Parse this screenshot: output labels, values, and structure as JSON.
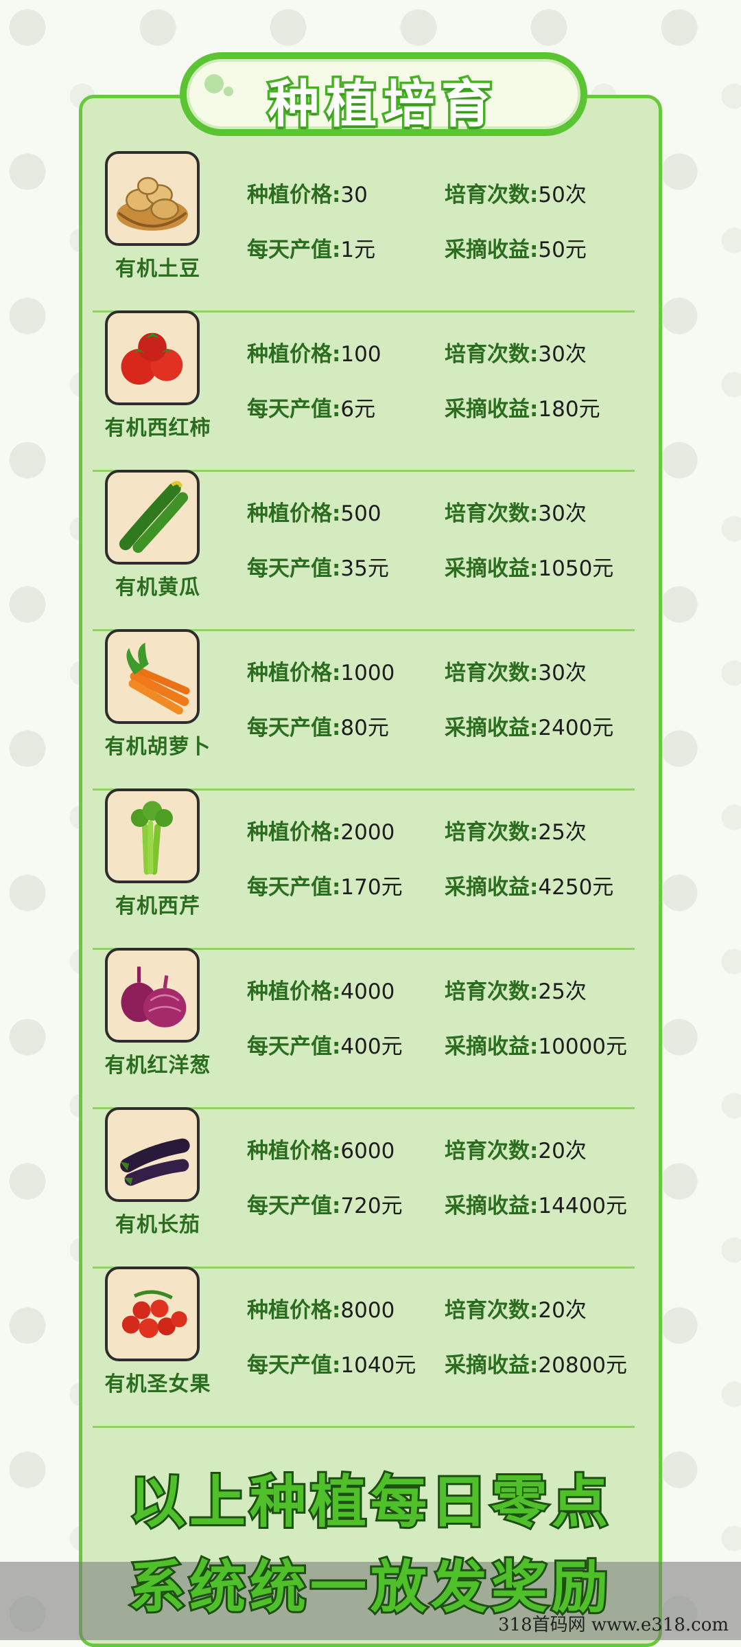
{
  "title": "种植培育",
  "labels": {
    "price": "种植价格:",
    "times": "培育次数:",
    "daily": "每天产值:",
    "harvest": "采摘收益:"
  },
  "items": [
    {
      "name": "有机土豆",
      "icon": "potato-icon",
      "price": "30",
      "times": "50次",
      "daily": "1元",
      "harvest": "50元"
    },
    {
      "name": "有机西红柿",
      "icon": "tomato-icon",
      "price": "100",
      "times": "30次",
      "daily": "6元",
      "harvest": "180元"
    },
    {
      "name": "有机黄瓜",
      "icon": "cucumber-icon",
      "price": "500",
      "times": "30次",
      "daily": "35元",
      "harvest": "1050元"
    },
    {
      "name": "有机胡萝卜",
      "icon": "carrot-icon",
      "price": "1000",
      "times": "30次",
      "daily": "80元",
      "harvest": "2400元"
    },
    {
      "name": "有机西芹",
      "icon": "celery-icon",
      "price": "2000",
      "times": "25次",
      "daily": "170元",
      "harvest": "4250元"
    },
    {
      "name": "有机红洋葱",
      "icon": "onion-icon",
      "price": "4000",
      "times": "25次",
      "daily": "400元",
      "harvest": "10000元"
    },
    {
      "name": "有机长茄",
      "icon": "eggplant-icon",
      "price": "6000",
      "times": "20次",
      "daily": "720元",
      "harvest": "14400元"
    },
    {
      "name": "有机圣女果",
      "icon": "cherry-tomato-icon",
      "price": "8000",
      "times": "20次",
      "daily": "1040元",
      "harvest": "20800元"
    }
  ],
  "footer": {
    "line1": "以上种植每日零点",
    "line2": "系统统一放发奖励"
  },
  "watermark": "318首码网 www.e318.com",
  "colors": {
    "accent": "#5bc432",
    "panel": "#d3ebbf",
    "text": "#2b6d1f"
  }
}
